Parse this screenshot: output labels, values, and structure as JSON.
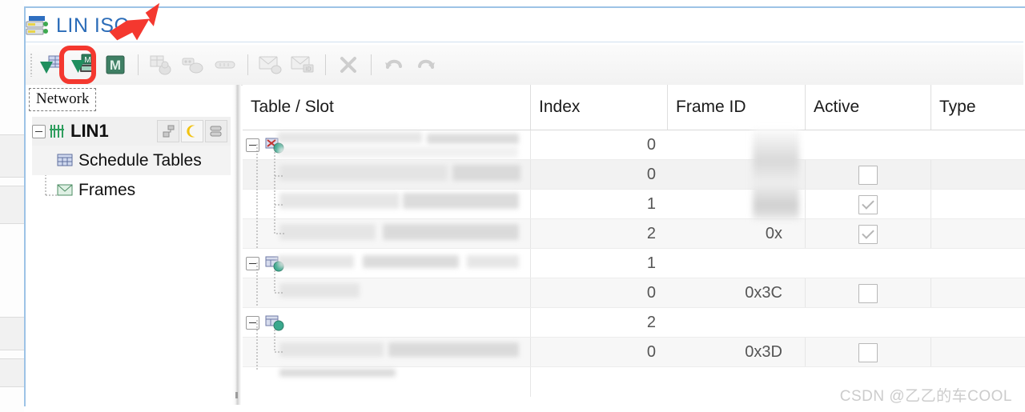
{
  "window": {
    "title": "LIN ISC",
    "title_icon": "lin-network-icon"
  },
  "toolbar": {
    "buttons": [
      {
        "name": "add-lin-network-button",
        "icon": "network-add-icon",
        "enabled": true,
        "highlighted": false
      },
      {
        "name": "add-master-node-button",
        "icon": "master-node-add-icon",
        "enabled": true,
        "highlighted": true
      },
      {
        "name": "master-mode-button",
        "icon": "letter-m-icon",
        "enabled": true,
        "highlighted": false
      },
      {
        "name": "add-slave-node-button",
        "icon": "slave-node-icon",
        "enabled": false,
        "highlighted": false
      },
      {
        "name": "add-subnode-button",
        "icon": "subnode-icon",
        "enabled": false,
        "highlighted": false
      },
      {
        "name": "add-signal-button",
        "icon": "signal-icon",
        "enabled": false,
        "highlighted": false
      },
      {
        "name": "add-frame-button",
        "icon": "frame-envelope-icon",
        "enabled": false,
        "highlighted": false
      },
      {
        "name": "add-diagnostic-frame-button",
        "icon": "frame-envelope-id-icon",
        "enabled": false,
        "highlighted": false
      },
      {
        "name": "delete-button",
        "icon": "delete-x-icon",
        "enabled": false,
        "highlighted": false
      },
      {
        "name": "undo-button",
        "icon": "undo-arrow-icon",
        "enabled": false,
        "highlighted": false
      },
      {
        "name": "redo-button",
        "icon": "redo-arrow-icon",
        "enabled": false,
        "highlighted": false
      }
    ]
  },
  "annotations": {
    "arrow": {
      "name": "red-arrow-annotation",
      "color": "#f4382f"
    },
    "rectangle": {
      "name": "red-highlight-rectangle",
      "color": "#f4382f"
    }
  },
  "tree_panel": {
    "tab_label": "Network",
    "root": {
      "label": "LIN1",
      "icon": "lin-bus-icon",
      "expanded": true,
      "badges": [
        {
          "name": "node-config-badge",
          "icon": "node-config-icon"
        },
        {
          "name": "sleep-mode-badge",
          "icon": "moon-icon"
        },
        {
          "name": "database-badge",
          "icon": "database-icon"
        }
      ]
    },
    "children": [
      {
        "label": "Schedule Tables",
        "icon": "schedule-table-icon",
        "selected": true
      },
      {
        "label": "Frames",
        "icon": "frame-icon",
        "selected": false
      }
    ]
  },
  "table": {
    "columns": [
      {
        "key": "table_slot",
        "label": "Table / Slot"
      },
      {
        "key": "index",
        "label": "Index"
      },
      {
        "key": "frame_id",
        "label": "Frame ID"
      },
      {
        "key": "active",
        "label": "Active"
      },
      {
        "key": "type",
        "label": "Type"
      }
    ],
    "rows": [
      {
        "kind": "group",
        "expanded": true,
        "icon": "schedule-table-globe-icon",
        "table_slot": "",
        "index": "0",
        "frame_id": "",
        "active": null,
        "type": "",
        "redacted": true
      },
      {
        "kind": "slot",
        "table_slot": "",
        "index": "0",
        "frame_id": "0x",
        "frame_id_redacted": true,
        "active": false,
        "type": "",
        "redacted": true,
        "selected": true
      },
      {
        "kind": "slot",
        "table_slot": "",
        "index": "1",
        "frame_id": "0x",
        "frame_id_redacted": true,
        "active": true,
        "type": "",
        "redacted": true
      },
      {
        "kind": "slot",
        "table_slot": "",
        "index": "2",
        "frame_id": "0x",
        "frame_id_redacted": true,
        "active": true,
        "type": "",
        "redacted": true
      },
      {
        "kind": "group",
        "expanded": true,
        "icon": "schedule-table-globe-icon",
        "table_slot": "",
        "index": "1",
        "frame_id": "",
        "active": null,
        "type": "",
        "redacted": true
      },
      {
        "kind": "slot",
        "table_slot": "",
        "index": "0",
        "frame_id": "0x3C",
        "frame_id_redacted": false,
        "active": false,
        "type": "",
        "redacted": true
      },
      {
        "kind": "group",
        "expanded": true,
        "icon": "schedule-table-globe-icon",
        "table_slot": "",
        "index": "2",
        "frame_id": "",
        "active": null,
        "type": "",
        "redacted": true
      },
      {
        "kind": "slot",
        "table_slot": "",
        "index": "0",
        "frame_id": "0x3D",
        "frame_id_redacted": false,
        "active": false,
        "type": "",
        "redacted": true
      }
    ]
  },
  "watermark": {
    "text": "CSDN @乙乙的车COOL"
  },
  "colors": {
    "accent": "#2b6cb8",
    "annotation": "#f4382f",
    "header_text": "#1a1a1a",
    "panel_bg": "#ffffff"
  }
}
